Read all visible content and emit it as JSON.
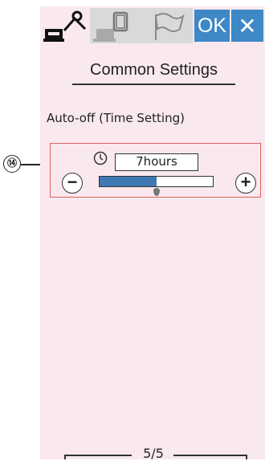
{
  "toolbar": {
    "tabs": [
      {
        "icon": "sewing-settings-icon",
        "active": true
      },
      {
        "icon": "embroidery-settings-icon",
        "active": false
      },
      {
        "icon": "language-flag-icon",
        "active": false
      }
    ],
    "ok_label": "OK",
    "close_label": "✕",
    "accent_color": "#3f88c6"
  },
  "page": {
    "title": "Common Settings",
    "section_label": "Auto-off (Time Setting)"
  },
  "auto_off": {
    "value": "7hours",
    "minus_label": "−",
    "plus_label": "+",
    "level_fraction": 0.5,
    "callout": "⑭"
  },
  "pager": {
    "label": "5/5"
  },
  "colors": {
    "screen_bg": "#f9e9ef",
    "group_border": "#e06060",
    "slider_fill": "#3f79b4"
  }
}
